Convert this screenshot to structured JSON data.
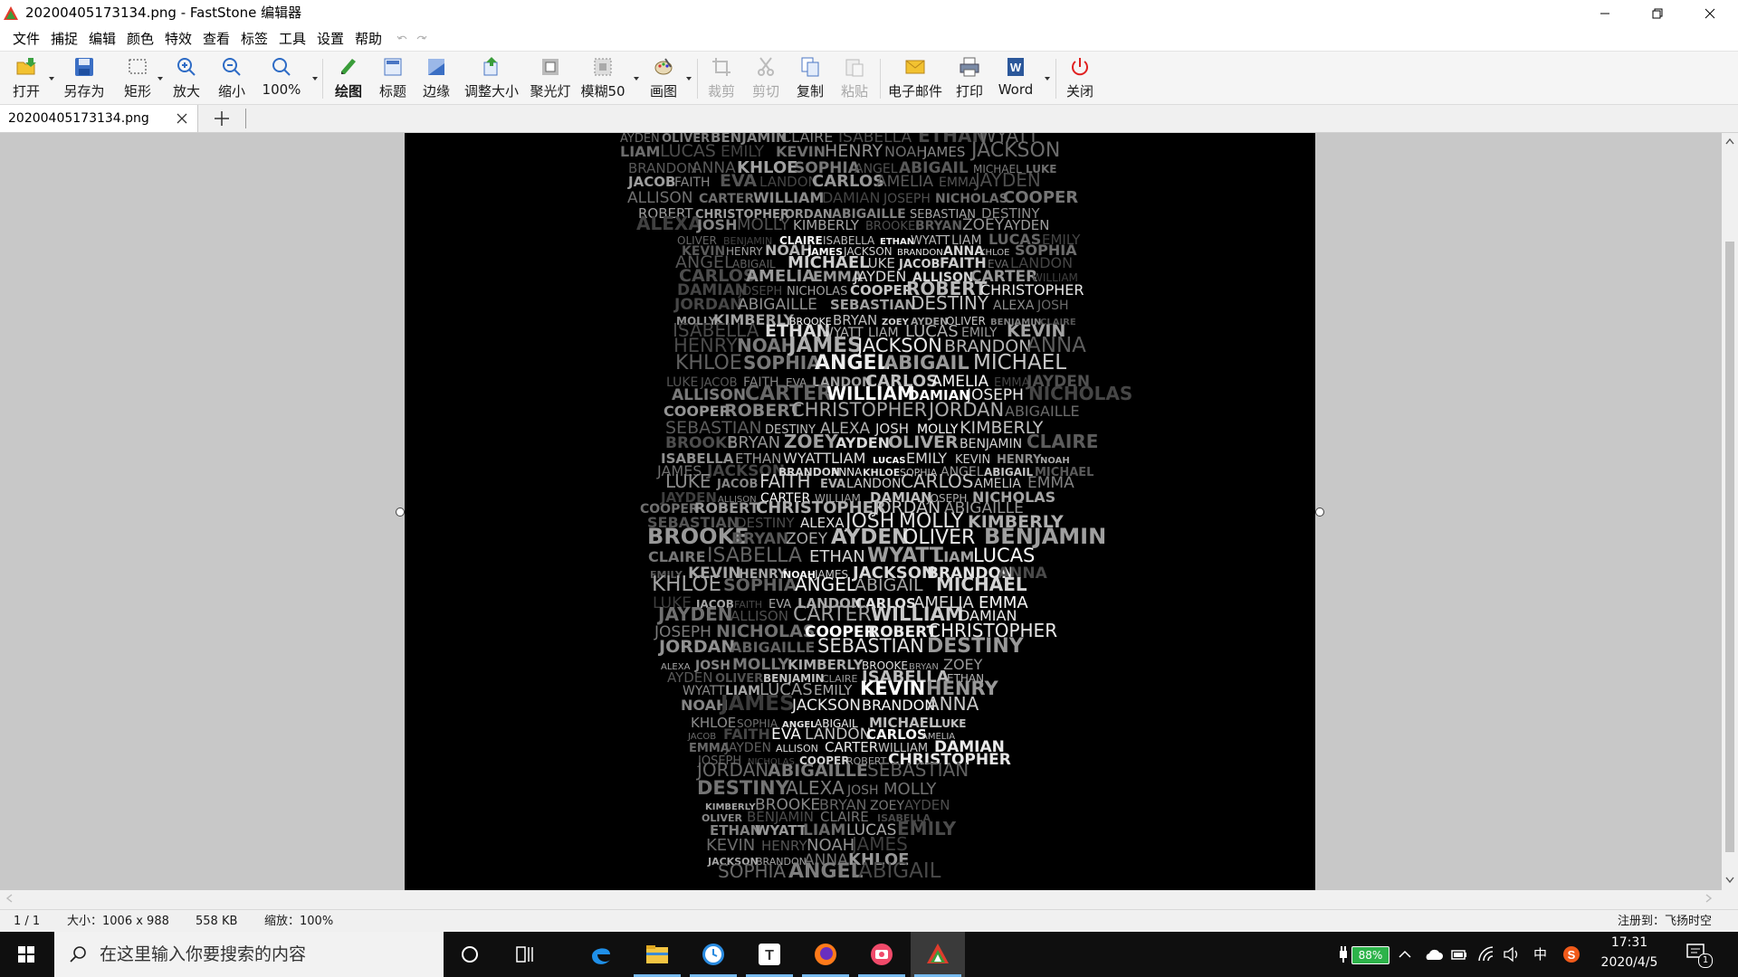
{
  "window": {
    "title": "20200405173134.png - FastStone 编辑器"
  },
  "menu": [
    "文件",
    "捕捉",
    "编辑",
    "颜色",
    "特效",
    "查看",
    "标签",
    "工具",
    "设置",
    "帮助"
  ],
  "toolbar": {
    "open": "打开",
    "save_as": "另存为",
    "rect": "矩形",
    "zoom_in": "放大",
    "zoom_out": "缩小",
    "zoom_100": "100%",
    "draw": "绘图",
    "caption": "标题",
    "edge": "边缘",
    "resize": "调整大小",
    "spotlight": "聚光灯",
    "blur": "模糊50",
    "canvas": "画图",
    "crop": "裁剪",
    "cut": "剪切",
    "copy": "复制",
    "paste": "粘贴",
    "email": "电子邮件",
    "print": "打印",
    "word": "Word",
    "close": "关闭"
  },
  "tabs": {
    "active": "20200405173134.png"
  },
  "canvas": {
    "art_words": [
      "AYDEN",
      "OLIVER",
      "BENJAMIN",
      "CLAIRE",
      "ISABELLA",
      "ETHAN",
      "WYATT",
      "LIAM",
      "LUCAS",
      "EMILY",
      "KEVIN",
      "HENRY",
      "NOAH",
      "JAMES",
      "JACKSON",
      "BRANDON",
      "ANNA",
      "KHLOE",
      "SOPHIA",
      "ANGEL",
      "ABIGAIL",
      "MICHAEL",
      "LUKE",
      "JACOB",
      "FAITH",
      "EVA",
      "LANDON",
      "CARLOS",
      "AMELIA",
      "EMMA",
      "JAYDEN",
      "ALLISON",
      "CARTER",
      "WILLIAM",
      "DAMIAN",
      "JOSEPH",
      "NICHOLAS",
      "COOPER",
      "ROBERT",
      "CHRISTOPHER",
      "JORDAN",
      "ABIGAILLE",
      "SEBASTIAN",
      "DESTINY",
      "ALEXA",
      "JOSH",
      "MOLLY",
      "KIMBERLY",
      "BROOKE",
      "BRYAN",
      "ZOEY"
    ]
  },
  "status": {
    "page": "1 / 1",
    "size": "大小：1006 x 988",
    "filesize": "558 KB",
    "zoom": "缩放：100%",
    "registered": "注册到：飞扬时空"
  },
  "taskbar": {
    "search_placeholder": "在这里输入你要搜索的内容",
    "battery": "88%",
    "ime": "中",
    "time": "17:31",
    "date": "2020/4/5",
    "notify_count": "1"
  },
  "colors": {
    "accent": "#0078d7",
    "image_bg": "#000000",
    "canvas_bg": "#c8c8c8"
  }
}
